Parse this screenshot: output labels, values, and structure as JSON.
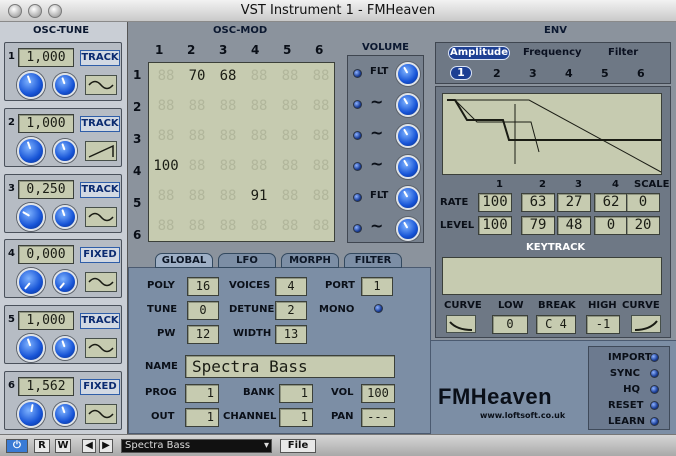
{
  "window": {
    "title": "VST Instrument 1 - FMHeaven"
  },
  "osc_tune": {
    "header": "OSC-TUNE",
    "rows": [
      {
        "num": "1",
        "value": "1,000",
        "mode": "TRACK"
      },
      {
        "num": "2",
        "value": "1,000",
        "mode": "TRACK"
      },
      {
        "num": "3",
        "value": "0,250",
        "mode": "TRACK"
      },
      {
        "num": "4",
        "value": "0,000",
        "mode": "FIXED"
      },
      {
        "num": "5",
        "value": "1,000",
        "mode": "TRACK"
      },
      {
        "num": "6",
        "value": "1,562",
        "mode": "FIXED"
      }
    ]
  },
  "osc_mod": {
    "header": "OSC-MOD",
    "cols": [
      "1",
      "2",
      "3",
      "4",
      "5",
      "6"
    ],
    "rows": [
      "1",
      "2",
      "3",
      "4",
      "5",
      "6"
    ],
    "cells": [
      [
        "",
        "70",
        "68",
        "",
        "",
        ""
      ],
      [
        "",
        "",
        "",
        "",
        "",
        ""
      ],
      [
        "",
        "",
        "",
        "",
        "",
        ""
      ],
      [
        "100",
        "",
        "",
        "",
        "",
        ""
      ],
      [
        "",
        "",
        "",
        "91",
        "",
        ""
      ],
      [
        "",
        "",
        "",
        "",
        "",
        ""
      ]
    ],
    "ghost": "88"
  },
  "volume": {
    "header": "VOLUME",
    "labels": [
      "FLT",
      "~",
      "~",
      "~",
      "FLT",
      "~"
    ]
  },
  "env": {
    "header": "ENV",
    "tabs": [
      "Amplitude",
      "Frequency",
      "Filter"
    ],
    "numbers": [
      "1",
      "2",
      "3",
      "4",
      "5",
      "6"
    ],
    "columns": [
      "1",
      "2",
      "3",
      "4",
      "SCALE"
    ],
    "rate_label": "RATE",
    "rate": [
      "100",
      "63",
      "27",
      "62",
      "0"
    ],
    "level_label": "LEVEL",
    "level": [
      "100",
      "79",
      "48",
      "0",
      "20"
    ],
    "keytrack": "KEYTRACK",
    "curve_label": "CURVE",
    "low_label": "LOW",
    "break_label": "BREAK",
    "high_label": "HIGH",
    "curve2_label": "CURVE",
    "low": "0",
    "break": "C 4",
    "high": "-1"
  },
  "global": {
    "tabs": [
      "GLOBAL",
      "LFO",
      "MORPH",
      "FILTER"
    ],
    "poly_label": "POLY",
    "poly": "16",
    "voices_label": "VOICES",
    "voices": "4",
    "port_label": "PORT",
    "port": "1",
    "tune_label": "TUNE",
    "tune": "0",
    "detune_label": "DETUNE",
    "detune": "2",
    "mono_label": "MONO",
    "pw_label": "PW",
    "pw": "12",
    "width_label": "WIDTH",
    "width": "13",
    "name_label": "NAME",
    "name": "Spectra Bass",
    "prog_label": "PROG",
    "prog": "1",
    "bank_label": "BANK",
    "bank": "1",
    "vol_label": "VOL",
    "vol": "100",
    "out_label": "OUT",
    "out": "1",
    "channel_label": "CHANNEL",
    "channel": "1",
    "pan_label": "PAN",
    "pan": "---"
  },
  "side": {
    "labels": [
      "IMPORT",
      "SYNC",
      "HQ",
      "RESET",
      "LEARN"
    ]
  },
  "brand": {
    "name": "FMHeaven",
    "url": "www.loftsoft.co.uk"
  },
  "bottom": {
    "r": "R",
    "w": "W",
    "prev": "◀",
    "next": "▶",
    "preset": "Spectra Bass",
    "file": "File"
  }
}
